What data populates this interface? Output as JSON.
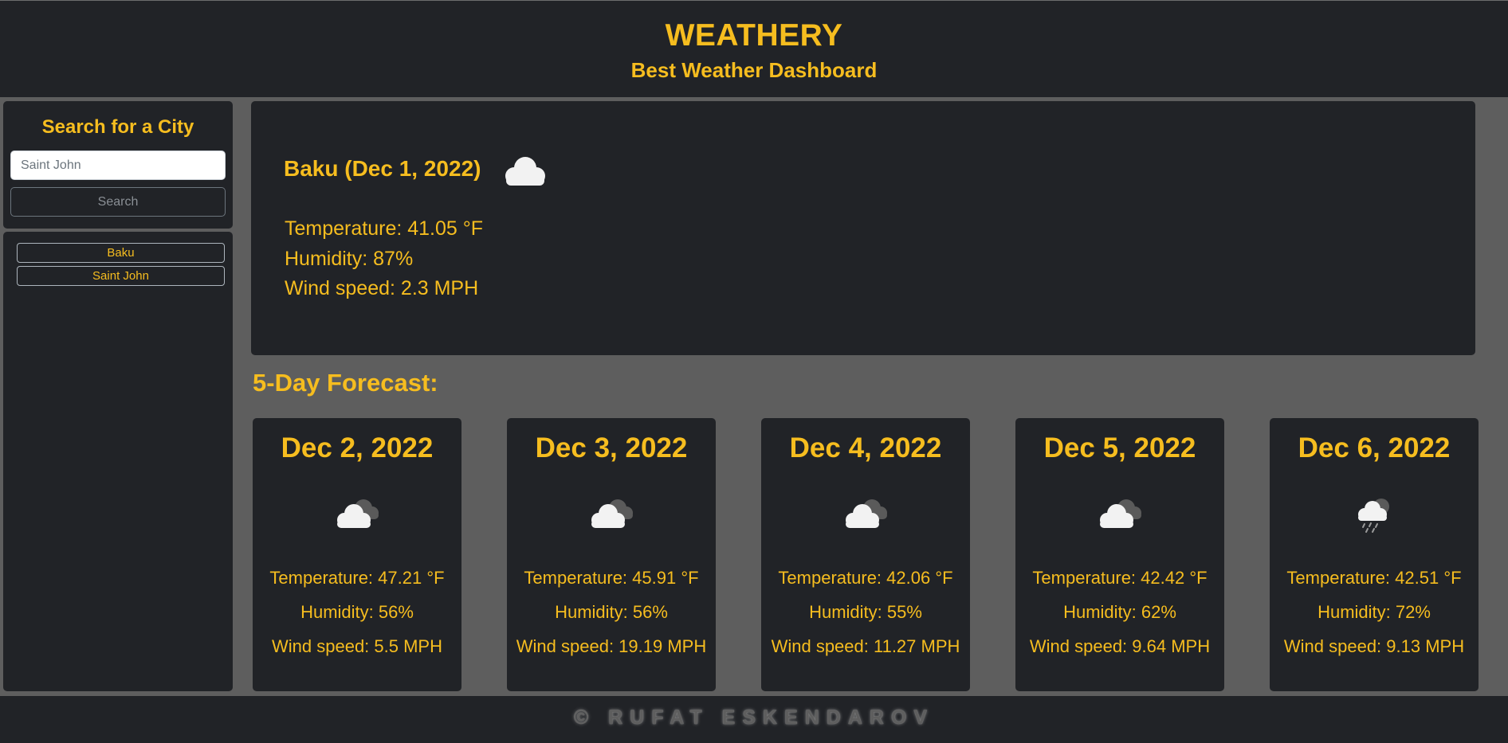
{
  "header": {
    "title": "WEATHERY",
    "subtitle": "Best Weather Dashboard"
  },
  "search": {
    "heading": "Search for a City",
    "placeholder": "Saint John",
    "button_label": "Search"
  },
  "history": [
    {
      "label": "Baku"
    },
    {
      "label": "Saint John"
    }
  ],
  "current": {
    "city_date": "Baku (Dec 1, 2022)",
    "icon": "cloud-icon",
    "temperature": "Temperature: 41.05 °F",
    "humidity": "Humidity: 87%",
    "wind": "Wind speed: 2.3 MPH"
  },
  "forecast": {
    "heading": "5-Day Forecast:",
    "days": [
      {
        "date": "Dec 2, 2022",
        "icon": "broken-clouds-icon",
        "temperature": "Temperature: 47.21 °F",
        "humidity": "Humidity: 56%",
        "wind": "Wind speed: 5.5 MPH"
      },
      {
        "date": "Dec 3, 2022",
        "icon": "broken-clouds-icon",
        "temperature": "Temperature: 45.91 °F",
        "humidity": "Humidity: 56%",
        "wind": "Wind speed: 19.19 MPH"
      },
      {
        "date": "Dec 4, 2022",
        "icon": "broken-clouds-icon",
        "temperature": "Temperature: 42.06 °F",
        "humidity": "Humidity: 55%",
        "wind": "Wind speed: 11.27 MPH"
      },
      {
        "date": "Dec 5, 2022",
        "icon": "broken-clouds-icon",
        "temperature": "Temperature: 42.42 °F",
        "humidity": "Humidity: 62%",
        "wind": "Wind speed: 9.64 MPH"
      },
      {
        "date": "Dec 6, 2022",
        "icon": "rain-icon",
        "temperature": "Temperature: 42.51 °F",
        "humidity": "Humidity: 72%",
        "wind": "Wind speed: 9.13 MPH"
      }
    ]
  },
  "footer": {
    "text": "© RUFAT ESKENDAROV"
  },
  "colors": {
    "accent": "#f6bd1f",
    "panel": "#212327",
    "background": "#5e5e5e"
  }
}
